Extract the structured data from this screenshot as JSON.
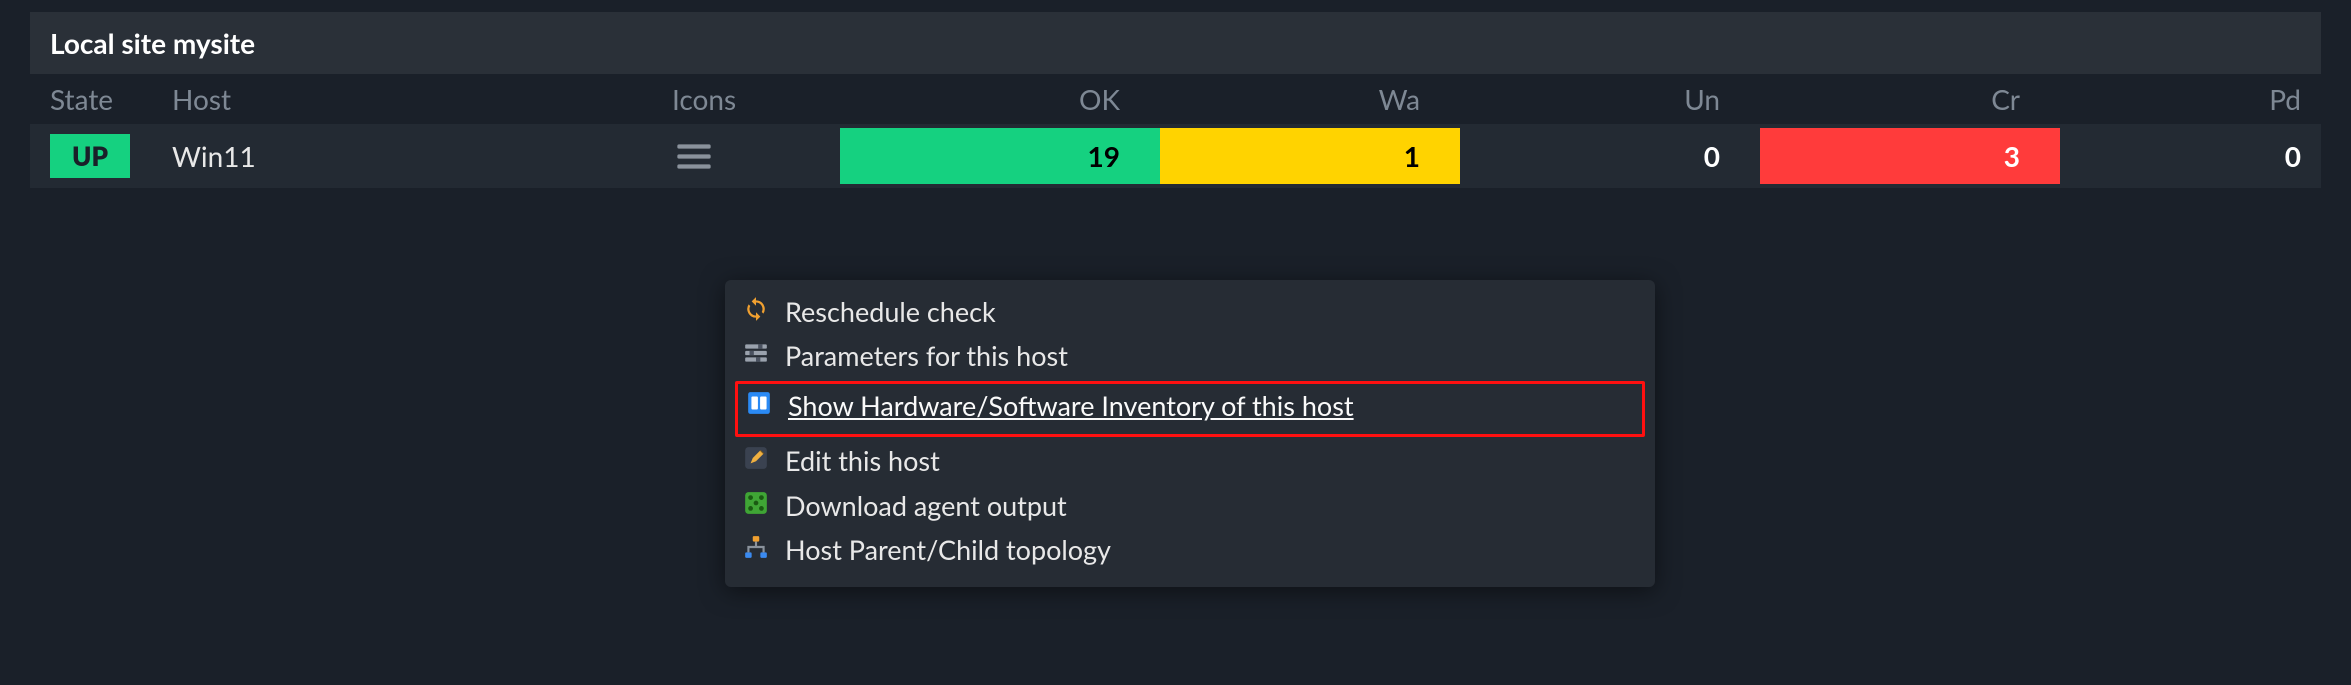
{
  "panel": {
    "title": "Local site mysite"
  },
  "columns": {
    "state": "State",
    "host": "Host",
    "icons": "Icons",
    "ok": "OK",
    "wa": "Wa",
    "un": "Un",
    "cr": "Cr",
    "pd": "Pd"
  },
  "row": {
    "state": "UP",
    "host": "Win11",
    "ok": "19",
    "wa": "1",
    "un": "0",
    "cr": "3",
    "pd": "0"
  },
  "menu": {
    "items": [
      {
        "icon": "reschedule-icon",
        "label": "Reschedule check"
      },
      {
        "icon": "parameters-icon",
        "label": "Parameters for this host"
      },
      {
        "icon": "inventory-icon",
        "label": "Show Hardware/Software Inventory of this host"
      },
      {
        "icon": "edit-icon",
        "label": "Edit this host"
      },
      {
        "icon": "download-icon",
        "label": "Download agent output"
      },
      {
        "icon": "topology-icon",
        "label": "Host Parent/Child topology"
      }
    ],
    "highlighted_index": 2
  },
  "colors": {
    "ok": "#15d180",
    "wa": "#ffd300",
    "cr": "#ff3b3b",
    "highlight_border": "#ff1010"
  }
}
